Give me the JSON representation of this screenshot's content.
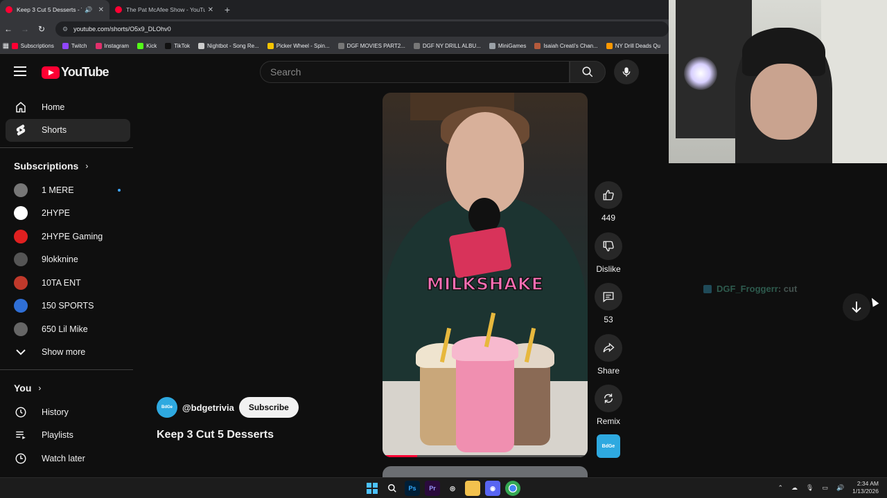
{
  "browser": {
    "tabs": [
      {
        "title": "Keep 3 Cut 5 Desserts - Yo",
        "active": true,
        "audio": true
      },
      {
        "title": "The Pat McAfee Show - YouTub",
        "active": false,
        "audio": false
      }
    ],
    "url": "youtube.com/shorts/O5x9_DLOhv0",
    "bookmarks": [
      {
        "label": "Subscriptions",
        "color": "#ff0033"
      },
      {
        "label": "Twitch",
        "color": "#9146ff"
      },
      {
        "label": "Instagram",
        "color": "#e1306c"
      },
      {
        "label": "Kick",
        "color": "#53fc18"
      },
      {
        "label": "TikTok",
        "color": "#111111"
      },
      {
        "label": "Nightbot - Song Re...",
        "color": "#cccccc"
      },
      {
        "label": "Picker Wheel - Spin...",
        "color": "#f5c400"
      },
      {
        "label": "DGF MOVIES PART2...",
        "color": "#777777"
      },
      {
        "label": "DGF NY DRILL ALBU...",
        "color": "#777777"
      },
      {
        "label": "MiniGames",
        "color": "#9aa0a6"
      },
      {
        "label": "Isaiah Creati's Chan...",
        "color": "#b55a3c"
      },
      {
        "label": "NY Drill Deads Qu",
        "color": "#ff9900"
      }
    ]
  },
  "header": {
    "logo_text": "YouTube",
    "search_placeholder": "Search"
  },
  "sidebar": {
    "main": [
      {
        "label": "Home",
        "icon": "home-icon",
        "active": false
      },
      {
        "label": "Shorts",
        "icon": "shorts-icon",
        "active": true
      }
    ],
    "subscriptions_title": "Subscriptions",
    "subscriptions": [
      {
        "label": "1 MERE",
        "color": "#777777",
        "new": true
      },
      {
        "label": "2HYPE",
        "color": "#ffffff",
        "new": false
      },
      {
        "label": "2HYPE Gaming",
        "color": "#e02020",
        "new": false
      },
      {
        "label": "9lokknine",
        "color": "#555555",
        "new": false
      },
      {
        "label": "10TA ENT",
        "color": "#c0392b",
        "new": false
      },
      {
        "label": "150 SPORTS",
        "color": "#2f6fd6",
        "new": false
      },
      {
        "label": "650 Lil Mike",
        "color": "#666666",
        "new": false
      }
    ],
    "show_more": "Show more",
    "you_title": "You",
    "you": [
      {
        "label": "History",
        "icon": "history-icon"
      },
      {
        "label": "Playlists",
        "icon": "playlists-icon"
      },
      {
        "label": "Watch later",
        "icon": "watch-later-icon"
      }
    ]
  },
  "short": {
    "caption": "MILKSHAKE",
    "channel_handle": "@bdgetrivia",
    "subscribe_label": "Subscribe",
    "title": "Keep 3 Cut 5 Desserts",
    "progress_fraction": 0.17,
    "likes": "449",
    "dislike_label": "Dislike",
    "comments": "53",
    "share_label": "Share",
    "remix_label": "Remix"
  },
  "overlay": {
    "chat_user": "DGF_Froggerr",
    "chat_message": ": cut"
  },
  "taskbar": {
    "time": "2:34 AM",
    "date": "1/13/2026"
  }
}
